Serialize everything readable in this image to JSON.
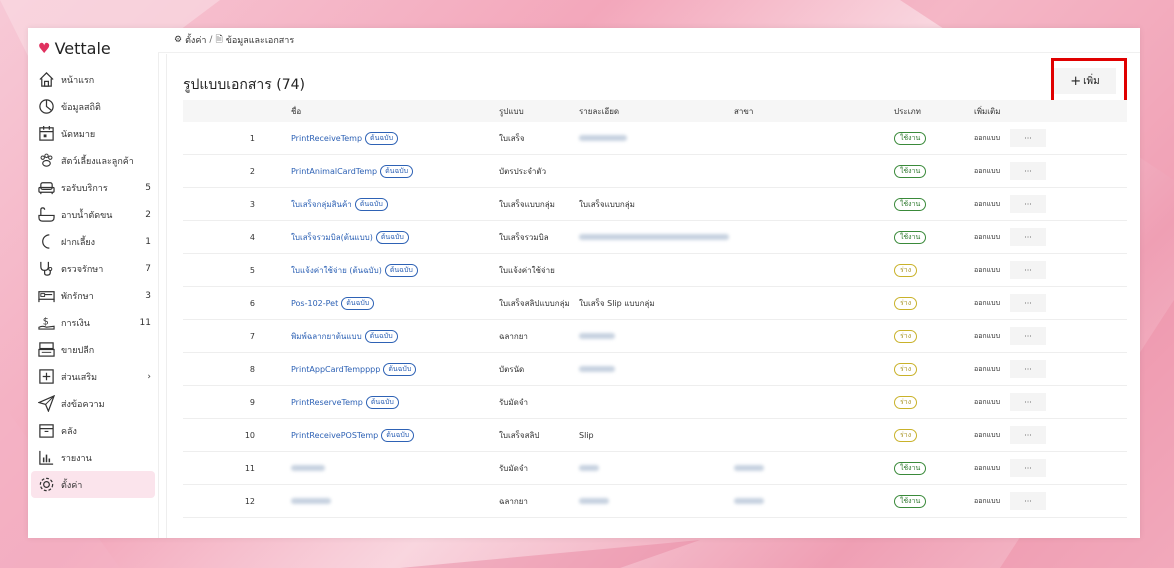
{
  "brand": {
    "name": "Vettale",
    "color": "#e0315f"
  },
  "breadcrumb": {
    "root": "ตั้งค่า",
    "separator": "/",
    "current": "ข้อมูลและเอกสาร"
  },
  "sidebar": {
    "items": [
      {
        "label": "หน้าแรก",
        "icon": "home-icon",
        "count": ""
      },
      {
        "label": "ข้อมูลสถิติ",
        "icon": "stats-icon",
        "count": ""
      },
      {
        "label": "นัดหมาย",
        "icon": "calendar-icon",
        "count": ""
      },
      {
        "label": "สัตว์เลี้ยงและลูกค้า",
        "icon": "paw-icon",
        "count": ""
      },
      {
        "label": "รอรับบริการ",
        "icon": "sofa-icon",
        "count": "5"
      },
      {
        "label": "อาบน้ำตัดขน",
        "icon": "bathtub-icon",
        "count": "2"
      },
      {
        "label": "ฝากเลี้ยง",
        "icon": "moon-icon",
        "count": "1"
      },
      {
        "label": "ตรวจรักษา",
        "icon": "stethoscope-icon",
        "count": "7"
      },
      {
        "label": "พักรักษา",
        "icon": "bed-icon",
        "count": "3"
      },
      {
        "label": "การเงิน",
        "icon": "money-icon",
        "count": "11"
      },
      {
        "label": "ขายปลีก",
        "icon": "register-icon",
        "count": ""
      },
      {
        "label": "ส่วนเสริม",
        "icon": "plus-square-icon",
        "count": "›"
      },
      {
        "label": "ส่งข้อความ",
        "icon": "send-icon",
        "count": ""
      },
      {
        "label": "คลัง",
        "icon": "warehouse-icon",
        "count": ""
      },
      {
        "label": "รายงาน",
        "icon": "chart-icon",
        "count": ""
      },
      {
        "label": "ตั้งค่า",
        "icon": "gear-icon",
        "count": "",
        "active": true
      }
    ]
  },
  "page": {
    "title": "รูปแบบเอกสาร (74)",
    "add_label": "เพิ่ม",
    "add_symbol": "+"
  },
  "table": {
    "headers": {
      "name": "ชื่อ",
      "type": "รูปแบบ",
      "desc": "รายละเอียด",
      "branch": "สาขา",
      "status": "ประเภท",
      "extra": "เพิ่มเติม"
    },
    "design_label": "ออกแบบ",
    "more_label": "···",
    "original_badge": "ต้นฉบับ",
    "rows": [
      {
        "no": "1",
        "name": "PrintReceiveTemp",
        "original": true,
        "type": "ใบเสร็จ",
        "desc_blur": 48,
        "branch_blur": 0,
        "status": "ใช้งาน",
        "draft": false
      },
      {
        "no": "2",
        "name": "PrintAnimalCardTemp",
        "original": true,
        "type": "บัตรประจำตัว",
        "desc_blur": 0,
        "branch_blur": 0,
        "status": "ใช้งาน",
        "draft": false
      },
      {
        "no": "3",
        "name": "ใบเสร็จกลุ่มสินค้า",
        "original": true,
        "type": "ใบเสร็จแบบกลุ่ม",
        "desc": "ใบเสร็จแบบกลุ่ม",
        "desc_blur": 0,
        "branch_blur": 0,
        "status": "ใช้งาน",
        "draft": false
      },
      {
        "no": "4",
        "name": "ใบเสร็จรวมบิล(ต้นแบบ)",
        "original": true,
        "type": "ใบเสร็จรวมบิล",
        "desc_blur": 150,
        "branch_blur": 0,
        "status": "ใช้งาน",
        "draft": false
      },
      {
        "no": "5",
        "name": "ใบแจ้งค่าใช้จ่าย (ต้นฉบับ)",
        "original": true,
        "type": "ใบแจ้งค่าใช้จ่าย",
        "desc_blur": 0,
        "branch_blur": 0,
        "status": "ร่าง",
        "draft": true
      },
      {
        "no": "6",
        "name": "Pos-102-Pet",
        "original": true,
        "type": "ใบเสร็จสลิปแบบกลุ่ม",
        "desc": "ใบเสร็จ Slip แบบกลุ่ม",
        "desc_blur": 0,
        "branch_blur": 0,
        "status": "ร่าง",
        "draft": true
      },
      {
        "no": "7",
        "name": "พิมพ์ฉลากยาต้นแบบ",
        "original": true,
        "type": "ฉลากยา",
        "desc_blur": 36,
        "branch_blur": 0,
        "status": "ร่าง",
        "draft": true
      },
      {
        "no": "8",
        "name": "PrintAppCardTempppp",
        "original": true,
        "type": "บัตรนัด",
        "desc_blur": 36,
        "branch_blur": 0,
        "status": "ร่าง",
        "draft": true
      },
      {
        "no": "9",
        "name": "PrintReserveTemp",
        "original": true,
        "type": "รับมัดจำ",
        "desc_blur": 0,
        "branch_blur": 0,
        "status": "ร่าง",
        "draft": true
      },
      {
        "no": "10",
        "name": "PrintReceivePOSTemp",
        "original": true,
        "type": "ใบเสร็จสลิป",
        "desc": "Slip",
        "desc_blur": 0,
        "branch_blur": 0,
        "status": "ร่าง",
        "draft": true
      },
      {
        "no": "11",
        "name": "",
        "name_blur": 34,
        "original": false,
        "type": "รับมัดจำ",
        "desc_blur": 20,
        "branch_blur": 30,
        "status": "ใช้งาน",
        "draft": false
      },
      {
        "no": "12",
        "name": "",
        "name_blur": 40,
        "original": false,
        "type": "ฉลากยา",
        "desc_blur": 30,
        "branch_blur": 30,
        "status": "ใช้งาน",
        "draft": false
      }
    ]
  },
  "colors": {
    "link": "#2e62b5",
    "active_green": "#3a8a3a",
    "draft_yellow": "#c9b22a",
    "highlight": "#e00000",
    "sidebar_active": "#fbe4ec"
  }
}
